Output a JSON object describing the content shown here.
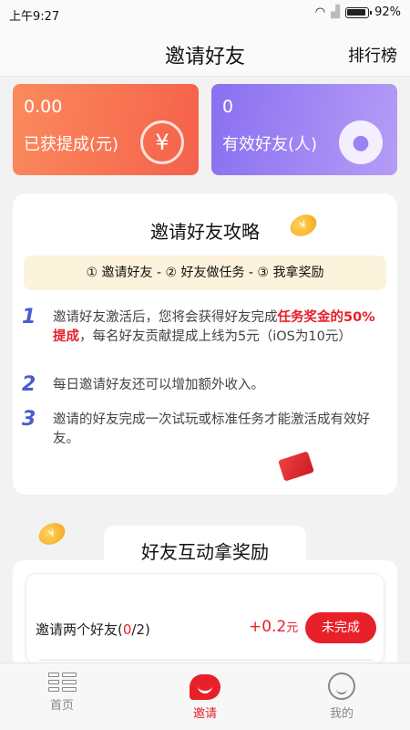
{
  "status_bar": {
    "time": "上午9:27",
    "battery": "92%"
  },
  "navbar": {
    "title": "邀请好友",
    "right_action": "排行榜"
  },
  "stats": [
    {
      "value": "0.00",
      "label": "已获提成(元)",
      "icon": "yuan-icon",
      "color": "#f5714f"
    },
    {
      "value": "0",
      "label": "有效好友(人)",
      "icon": "person-icon",
      "color": "#9a82f3"
    }
  ],
  "guide": {
    "title": "邀请好友攻略",
    "steps": "① 邀请好友 - ② 好友做任务 - ③ 我拿奖励",
    "rules": [
      {
        "num": "1",
        "text_a": "邀请好友激活后，您将会获得好友完成",
        "highlight": "任务奖金的50%提成",
        "text_b": "，每名好友贡献提成上线为5元（iOS为10元）"
      },
      {
        "num": "2",
        "text": "每日邀请好友还可以增加额外收入。"
      },
      {
        "num": "3",
        "text": "邀请的好友完成一次试玩或标准任务才能激活成有效好友。"
      }
    ]
  },
  "rewards": {
    "title": "好友互动拿奖励",
    "tasks": [
      {
        "name": "邀请两个好友(",
        "done": "0",
        "total": "/2)",
        "reward": "+0.2",
        "unit": "元",
        "status": "未完成"
      }
    ]
  },
  "tabbar": {
    "items": [
      {
        "label": "首页",
        "icon": "grid-icon"
      },
      {
        "label": "邀请",
        "icon": "chat-bubble-icon",
        "active": true
      },
      {
        "label": "我的",
        "icon": "smile-face-icon"
      }
    ]
  },
  "colors": {
    "accent": "#e8202a",
    "orange": "#f5714f",
    "purple": "#9a82f3",
    "cream": "#fcf3dc"
  }
}
